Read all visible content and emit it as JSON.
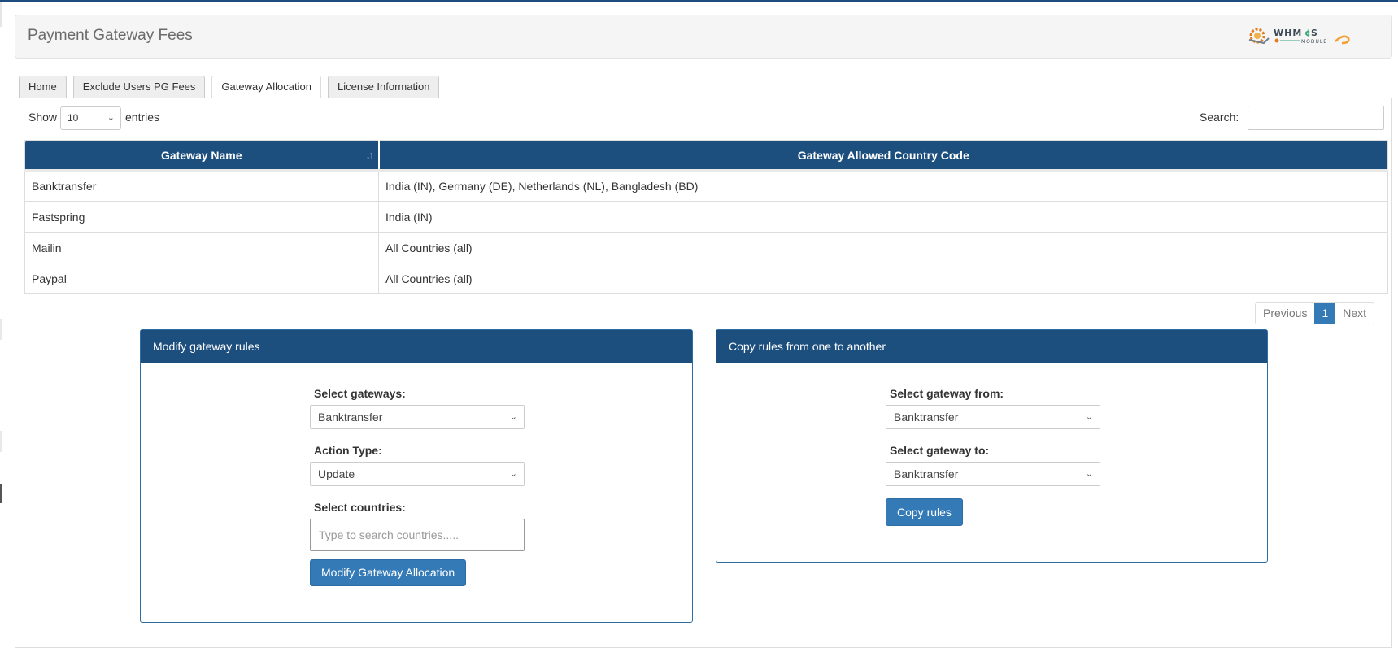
{
  "header": {
    "title": "Payment Gateway Fees",
    "logo": "WHMCS MODULE logo"
  },
  "tabs": [
    {
      "label": "Home",
      "active": false
    },
    {
      "label": "Exclude Users PG Fees",
      "active": false
    },
    {
      "label": "Gateway Allocation",
      "active": true
    },
    {
      "label": "License Information",
      "active": false
    }
  ],
  "table_controls": {
    "show_label": "Show",
    "entries_value": "10",
    "entries_label": "entries",
    "search_label": "Search:",
    "search_value": ""
  },
  "table": {
    "columns": [
      "Gateway Name",
      "Gateway Allowed Country Code"
    ],
    "rows": [
      [
        "Banktransfer",
        "India (IN), Germany (DE), Netherlands (NL), Bangladesh (BD)"
      ],
      [
        "Fastspring",
        "India (IN)"
      ],
      [
        "Mailin",
        "All Countries (all)"
      ],
      [
        "Paypal",
        "All Countries (all)"
      ]
    ]
  },
  "pagination": {
    "previous": "Previous",
    "current": "1",
    "next": "Next"
  },
  "modify_card": {
    "title": "Modify gateway rules",
    "gateways_label": "Select gateways:",
    "gateways_value": "Banktransfer",
    "action_label": "Action Type:",
    "action_value": "Update",
    "countries_label": "Select countries:",
    "countries_placeholder": "Type to search countries.....",
    "submit_label": "Modify Gateway Allocation"
  },
  "copy_card": {
    "title": "Copy rules from one to another",
    "from_label": "Select gateway from:",
    "from_value": "Banktransfer",
    "to_label": "Select gateway to:",
    "to_value": "Banktransfer",
    "submit_label": "Copy rules"
  },
  "colors": {
    "primary": "#1c4e7e",
    "button": "#337ab7"
  }
}
